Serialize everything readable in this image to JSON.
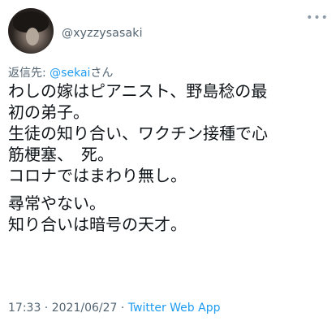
{
  "tweet": {
    "username": "@xyzzysasaki",
    "reply_prefix": "返信先: ",
    "reply_mention": "@sekai",
    "reply_suffix": "さん",
    "lines": [
      "わしの嫁はピアニスト、野島稔の最",
      "初の弟子。",
      "生徒の知り合い、ワクチン接種で心",
      "筋梗塞、　死。",
      "コロナではまわり無し。",
      "尋常やない。",
      "知り合いは暗号の天才。"
    ],
    "time": "17:33",
    "date": "2021/06/27",
    "separator": " · ",
    "source": "Twitter Web App",
    "more_icon": "ellipsis-icon"
  }
}
